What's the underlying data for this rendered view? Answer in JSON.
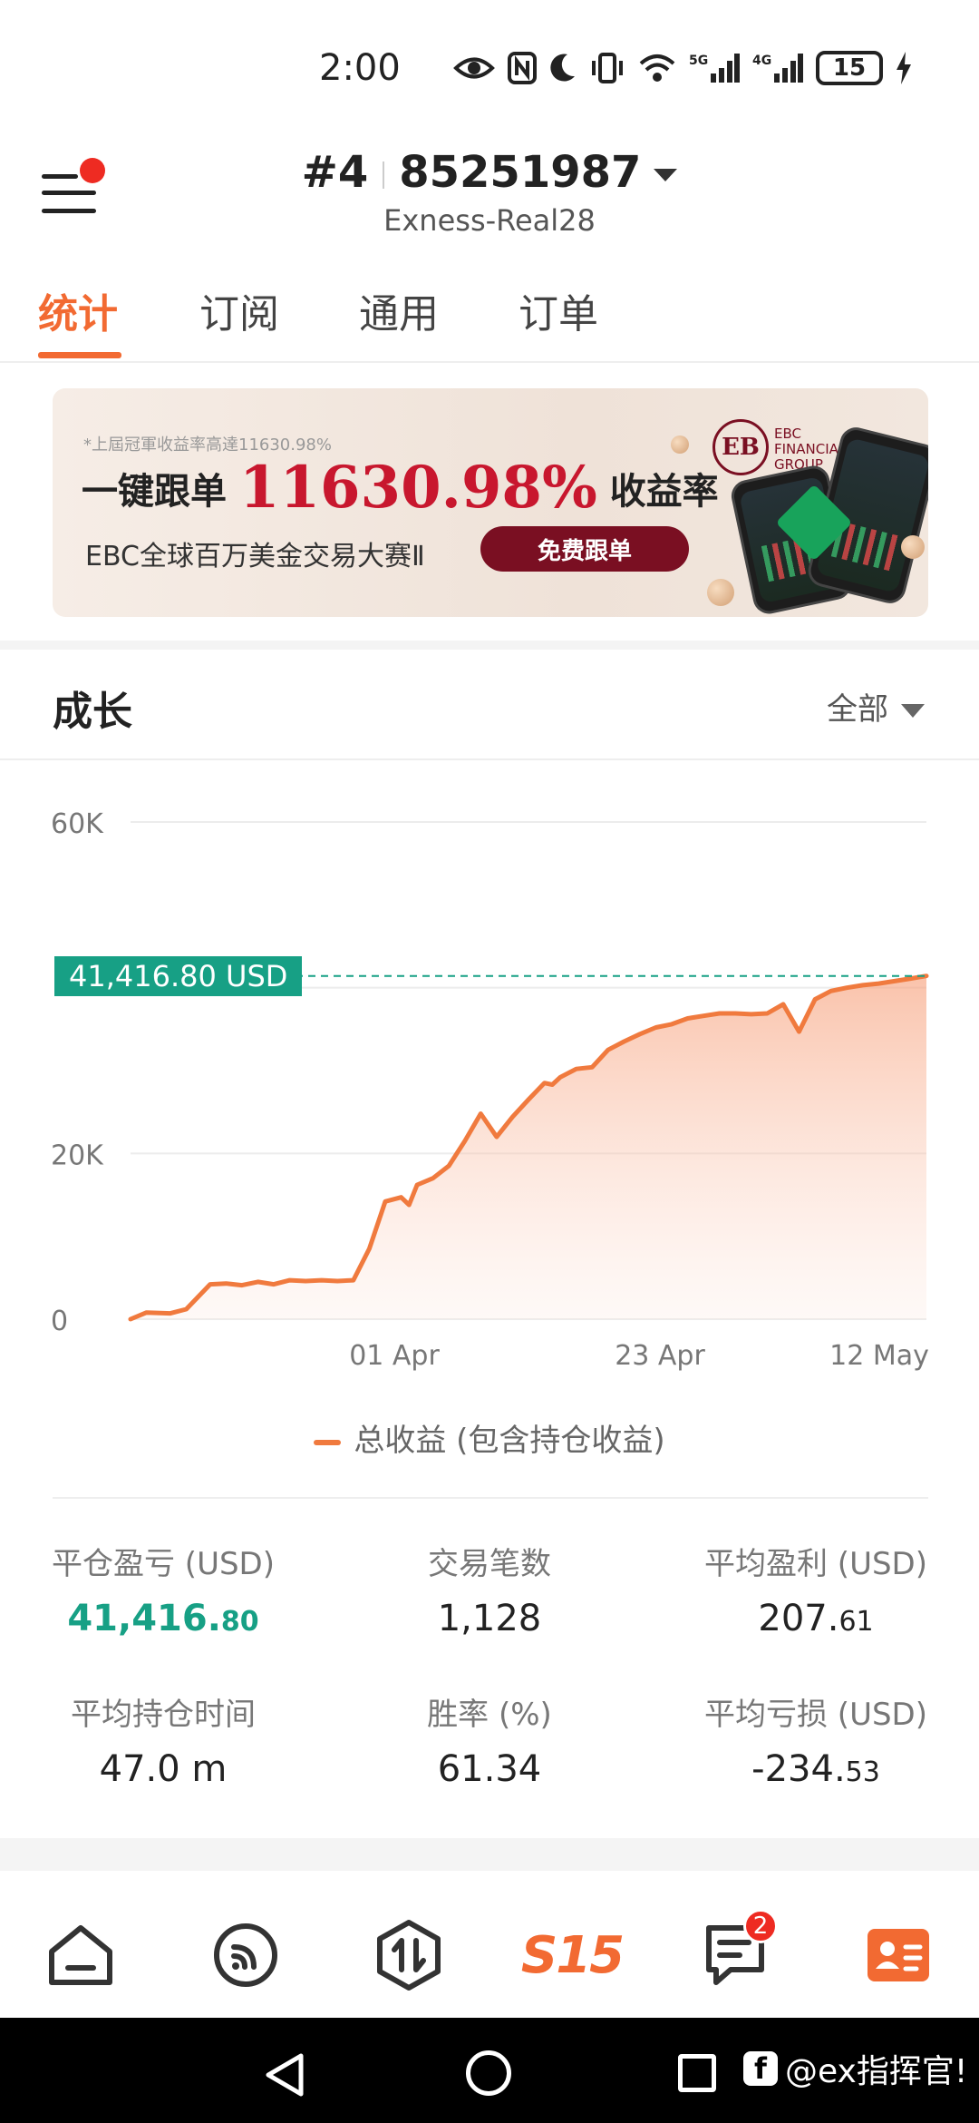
{
  "status_bar": {
    "time": "2:00",
    "network_1": "5G",
    "network_2": "4G",
    "battery": "15"
  },
  "header": {
    "account_prefix": "#4",
    "account_number": "85251987",
    "server": "Exness-Real28"
  },
  "tabs": [
    {
      "label": "统计",
      "active": true
    },
    {
      "label": "订阅",
      "active": false
    },
    {
      "label": "通用",
      "active": false
    },
    {
      "label": "订单",
      "active": false
    }
  ],
  "banner": {
    "note": "*上屆冠軍收益率高達11630.98%",
    "title_prefix": "一键跟单",
    "title_pct": "11630.98%",
    "title_suffix": "收益率",
    "subtitle": "EBC全球百万美金交易大赛Ⅱ",
    "button": "免费跟单",
    "brand_mark": "EB",
    "brand_line1": "EBC",
    "brand_line2": "FINANCIAL",
    "brand_line3": "GROUP"
  },
  "growth": {
    "title": "成长",
    "range": "全部",
    "current_value_tag": "41,416.80 USD",
    "legend": "总收益 (包含持仓收益)"
  },
  "chart_data": {
    "type": "area",
    "y_ticks": [
      "60K",
      "20K",
      "0"
    ],
    "y_tick_values": [
      60000,
      20000,
      0
    ],
    "x_ticks": [
      "01 Apr",
      "23 Apr",
      "12 May"
    ],
    "ylim": [
      0,
      60000
    ],
    "reference_line": 41416.8,
    "series": [
      {
        "x_index": [
          0,
          2,
          5,
          7,
          10,
          12,
          14,
          16,
          18,
          20,
          22,
          24,
          26,
          28,
          30,
          32,
          34,
          35,
          36,
          38,
          40,
          42,
          44,
          46,
          48,
          50,
          52,
          53,
          54,
          56,
          58,
          60,
          62,
          64,
          66,
          68,
          70,
          72,
          74,
          76,
          78,
          80,
          82,
          84,
          86,
          88,
          90,
          92,
          94,
          96,
          98,
          100
        ],
        "values": [
          0,
          800,
          700,
          1200,
          4200,
          4300,
          4100,
          4500,
          4200,
          4700,
          4600,
          4700,
          4600,
          4700,
          8500,
          14200,
          14700,
          13800,
          16200,
          17000,
          18500,
          21500,
          24800,
          22000,
          24400,
          26500,
          28500,
          28300,
          29200,
          30200,
          30400,
          32500,
          33500,
          34400,
          35200,
          35600,
          36300,
          36600,
          36900,
          36900,
          36800,
          36900,
          38000,
          34700,
          38600,
          39600,
          40000,
          40300,
          40500,
          40800,
          41100,
          41416.8
        ]
      }
    ],
    "color": "#f07a3e",
    "grid": true
  },
  "stats": [
    {
      "label": "平仓盈亏 (USD)",
      "value_main": "41,416.",
      "value_small": "80",
      "green": true
    },
    {
      "label": "交易笔数",
      "value_main": "1,128",
      "value_small": "",
      "green": false
    },
    {
      "label": "平均盈利 (USD)",
      "value_main": "207.",
      "value_small": "61",
      "green": false
    },
    {
      "label": "平均持仓时间",
      "value_main": "47.0 m",
      "value_small": "",
      "green": false
    },
    {
      "label": "胜率 (%)",
      "value_main": "61.34",
      "value_small": "",
      "green": false
    },
    {
      "label": "平均亏损 (USD)",
      "value_main": "-234.",
      "value_small": "53",
      "green": false
    }
  ],
  "bottom_nav": {
    "badge_count": "2",
    "center_label": "S15"
  },
  "watermark": "@ex指挥官!",
  "colors": {
    "accent": "#f26a32",
    "green": "#17a085",
    "badge": "#ee2b22"
  }
}
